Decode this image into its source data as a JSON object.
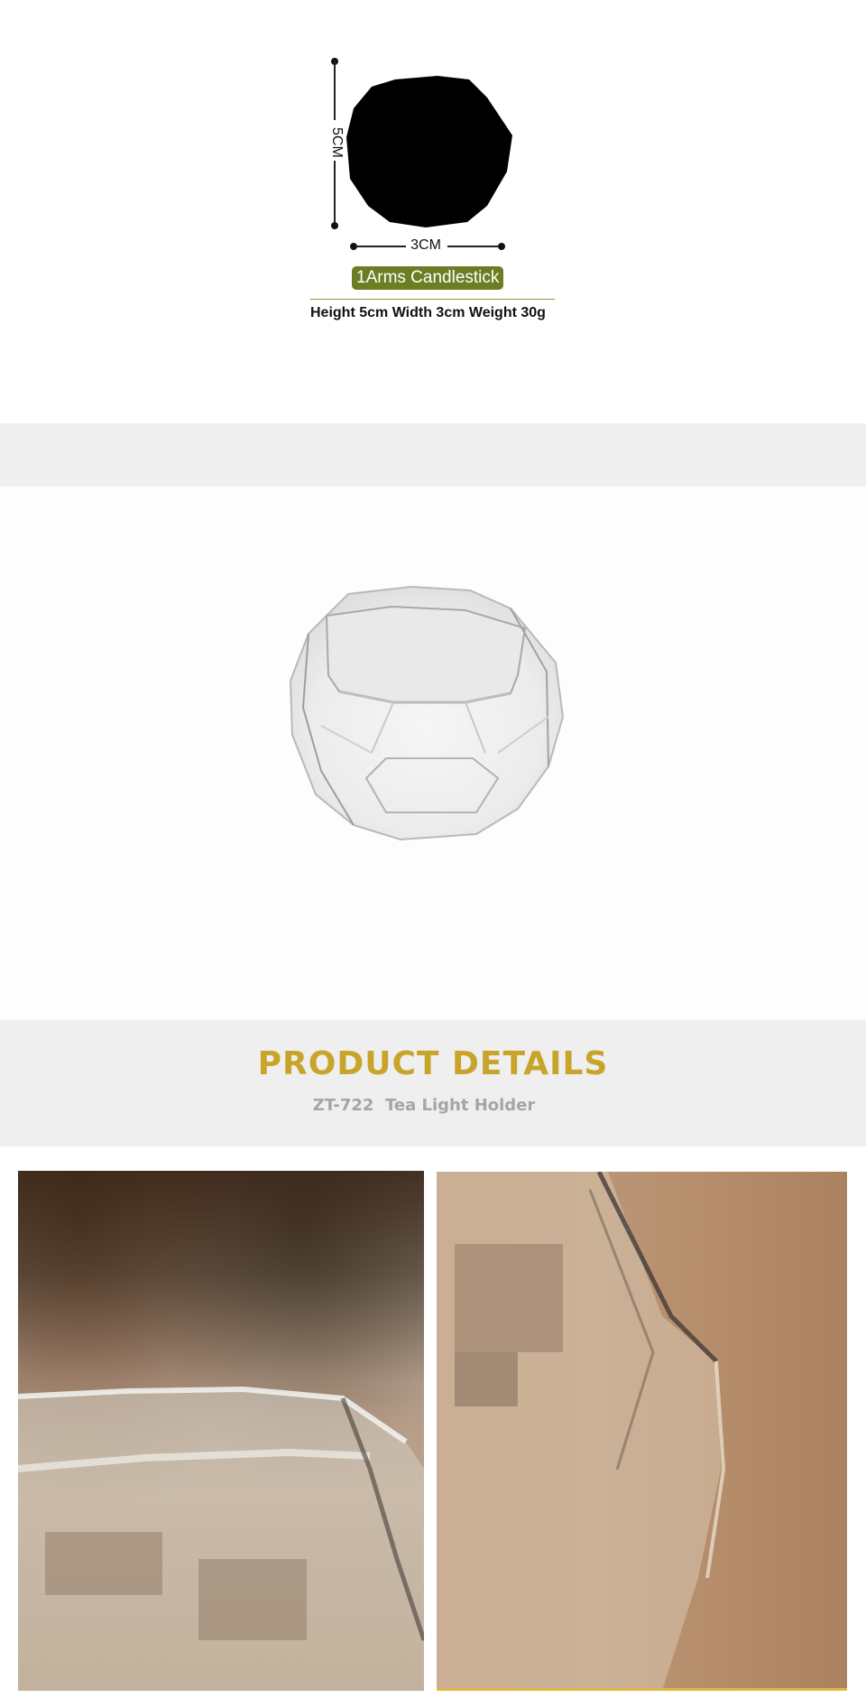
{
  "diagram": {
    "height_label": "5CM",
    "width_label": "3CM",
    "badge": "1Arms Candlestick",
    "specs": "Height 5cm Width 3cm  Weight 30g"
  },
  "details": {
    "title": "PRODUCT DETAILS",
    "subtitle": "ZT-722  Tea Light Holder"
  },
  "colors": {
    "badge_green": "#6b7e24",
    "title_gold": "#c8a42a",
    "subtitle_gray": "#a5a5a5",
    "band_gray": "#efefef"
  }
}
